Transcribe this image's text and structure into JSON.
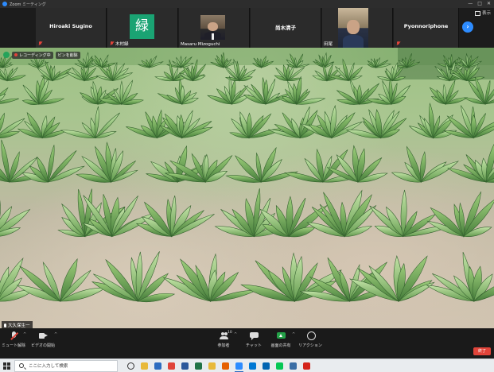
{
  "window": {
    "title": "Zoom ミーティング",
    "controls": [
      "—",
      "□",
      "✕"
    ]
  },
  "strip": {
    "display_label": "表示",
    "tiles": [
      {
        "name": "Hiroaki Sugino",
        "tag": "",
        "type": "name"
      },
      {
        "name": "",
        "tag": "木村緑",
        "type": "avatar",
        "avatar_text": "緑",
        "avatar_color": "#1aa373"
      },
      {
        "name": "",
        "tag": "Masaru Mizoguchi",
        "type": "photo"
      },
      {
        "name": "尚木清子",
        "tag": "",
        "type": "name"
      },
      {
        "name": "",
        "tag": "田尾",
        "type": "photo"
      },
      {
        "name": "Pyonnoriphone",
        "tag": "",
        "type": "name"
      }
    ]
  },
  "video": {
    "recording_label": "レコーディング中",
    "pin_label": "ピンを削除",
    "speaker_name": "大久保生一"
  },
  "toolbar": {
    "mute_label": "ミュート解除",
    "video_label": "ビデオの開始",
    "participants_label": "参加者",
    "participants_count": "10",
    "chat_label": "チャット",
    "share_label": "画面の共有",
    "reactions_label": "リアクション",
    "end_label": "終了"
  },
  "taskbar": {
    "search_placeholder": "ここに入力して検索",
    "apps": [
      {
        "name": "explorer",
        "color": "#e8b93a"
      },
      {
        "name": "mail",
        "color": "#2d6cc0"
      },
      {
        "name": "chrome",
        "color": "#e0443a"
      },
      {
        "name": "word",
        "color": "#2b579a"
      },
      {
        "name": "excel",
        "color": "#217346"
      },
      {
        "name": "chat-app",
        "color": "#e8b93a"
      },
      {
        "name": "firefox",
        "color": "#e66000"
      },
      {
        "name": "zoom",
        "color": "#2d8cff"
      },
      {
        "name": "outlook",
        "color": "#0078d4"
      },
      {
        "name": "photos",
        "color": "#0063b1"
      },
      {
        "name": "line",
        "color": "#06c755"
      },
      {
        "name": "app-blue",
        "color": "#3a6ea5"
      },
      {
        "name": "acrobat",
        "color": "#d4241b"
      }
    ]
  }
}
